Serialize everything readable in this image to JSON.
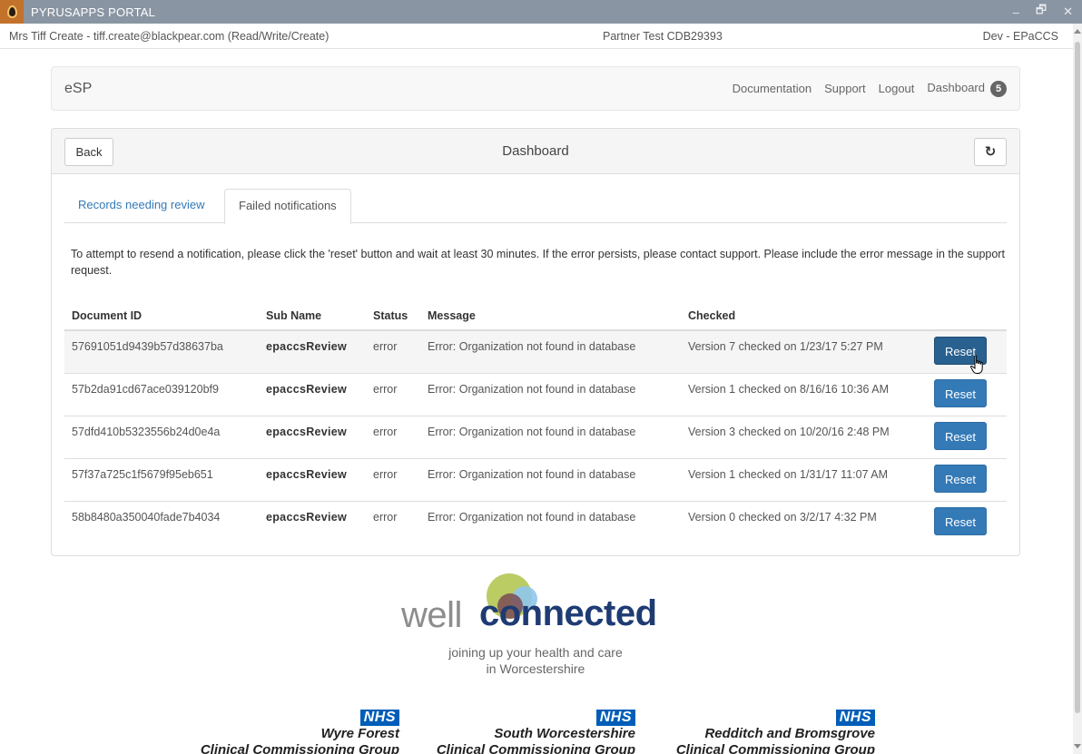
{
  "window": {
    "title": "PYRUSAPPS PORTAL",
    "minimize_glyph": "–",
    "restore_glyph": "🗗",
    "close_glyph": "✕"
  },
  "infobar": {
    "user": "Mrs Tiff Create - tiff.create@blackpear.com (Read/Write/Create)",
    "partner": "Partner Test CDB29393",
    "environment": "Dev - EPaCCS"
  },
  "navbar": {
    "brand": "eSP",
    "links": [
      "Documentation",
      "Support",
      "Logout",
      "Dashboard"
    ],
    "dashboard_badge": "5"
  },
  "panel": {
    "back_label": "Back",
    "title": "Dashboard",
    "refresh_icon": "refresh-icon",
    "refresh_glyph": "↻"
  },
  "tabs": [
    {
      "label": "Records needing review",
      "active": false
    },
    {
      "label": "Failed notifications",
      "active": true
    }
  ],
  "info_text": "To attempt to resend a notification, please click the 'reset' button and wait at least 30 minutes. If the error persists, please contact support. Please include the error message in the support request.",
  "table": {
    "headers": [
      "Document ID",
      "Sub Name",
      "Status",
      "Message",
      "Checked"
    ],
    "rows": [
      {
        "id": "57691051d9439b57d38637ba",
        "sub": "epaccsReview",
        "status": "error",
        "message": "Error: Organization not found in database",
        "checked": "Version 7 checked on 1/23/17 5:27 PM",
        "action": "Reset"
      },
      {
        "id": "57b2da91cd67ace039120bf9",
        "sub": "epaccsReview",
        "status": "error",
        "message": "Error: Organization not found in database",
        "checked": "Version 1 checked on 8/16/16 10:36 AM",
        "action": "Reset"
      },
      {
        "id": "57dfd410b5323556b24d0e4a",
        "sub": "epaccsReview",
        "status": "error",
        "message": "Error: Organization not found in database",
        "checked": "Version 3 checked on 10/20/16 2:48 PM",
        "action": "Reset"
      },
      {
        "id": "57f37a725c1f5679f95eb651",
        "sub": "epaccsReview",
        "status": "error",
        "message": "Error: Organization not found in database",
        "checked": "Version 1 checked on 1/31/17 11:07 AM",
        "action": "Reset"
      },
      {
        "id": "58b8480a350040fade7b4034",
        "sub": "epaccsReview",
        "status": "error",
        "message": "Error: Organization not found in database",
        "checked": "Version 0 checked on 3/2/17 4:32 PM",
        "action": "Reset"
      }
    ]
  },
  "footer": {
    "logo_well": "well",
    "logo_connected": "connected",
    "tagline_1": "joining up your health and care",
    "tagline_2": "in Worcestershire",
    "nhs_label": "NHS",
    "ccgs": [
      {
        "name": "Wyre Forest",
        "sub": "Clinical Commissioning Group"
      },
      {
        "name": "South Worcestershire",
        "sub": "Clinical Commissioning Group"
      },
      {
        "name": "Redditch and Bromsgrove",
        "sub": "Clinical Commissioning Group"
      }
    ]
  },
  "colors": {
    "titlebar": "#8a95a3",
    "primary_button": "#337ab7",
    "link": "#337ab7",
    "nhs_blue": "#005eb8",
    "logo_navy": "#1e3b73"
  }
}
